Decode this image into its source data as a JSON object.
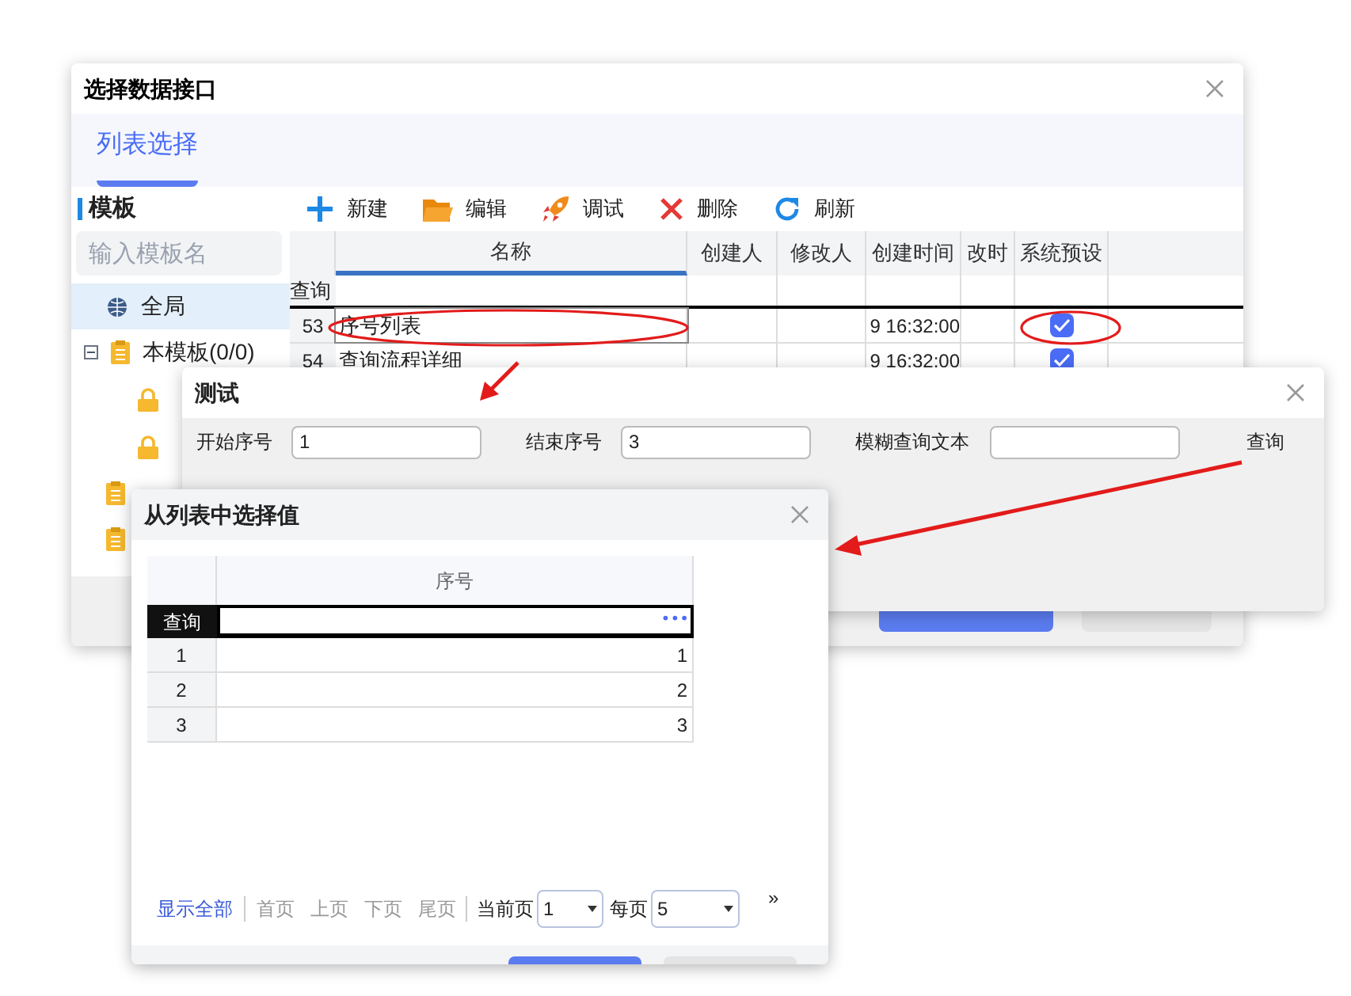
{
  "main_window": {
    "title": "选择数据接口",
    "tabs": [
      {
        "label": "列表选择",
        "selected": true
      }
    ],
    "sidebar": {
      "heading": "模板",
      "search": {
        "placeholder": "输入模板名"
      },
      "items": [
        {
          "label": "全局",
          "kind": "globe",
          "selected": true
        },
        {
          "label": "本模板(0/0)",
          "kind": "clipboard",
          "selected": false,
          "expanded": true,
          "children": [
            {
              "kind": "lock",
              "selected": false
            },
            {
              "kind": "lock",
              "selected": false
            }
          ]
        },
        {
          "kind": "clipboard",
          "selected": false
        },
        {
          "kind": "clipboard",
          "selected": false
        }
      ]
    },
    "toolbar": [
      {
        "kind": "new",
        "label": "新建"
      },
      {
        "kind": "edit",
        "label": "编辑"
      },
      {
        "kind": "debug",
        "label": "调试"
      },
      {
        "kind": "delete",
        "label": "删除"
      },
      {
        "kind": "refresh",
        "label": "刷新"
      }
    ],
    "table": {
      "columns": [
        "名称",
        "创建人",
        "修改人",
        "创建时间",
        "改时",
        "系统预设"
      ],
      "filter_label": "查询",
      "rows": [
        {
          "num": "53",
          "name": "序号列表",
          "created": "9 16:32:00",
          "preset": true,
          "selected": true
        },
        {
          "num": "54",
          "name": "查询流程详细",
          "created": "9 16:32:00",
          "preset": true,
          "selected": false
        }
      ]
    }
  },
  "test_window": {
    "title": "测试",
    "fields": [
      {
        "label": "开始序号",
        "value": "1"
      },
      {
        "label": "结束序号",
        "value": "3"
      },
      {
        "label": "模糊查询文本"
      }
    ],
    "query_button": "查询"
  },
  "picker_window": {
    "title": "从列表中选择值",
    "column": "序号",
    "filter_label": "查询",
    "filter_button": "•••",
    "rows": [
      {
        "num": "1",
        "value": "1"
      },
      {
        "num": "2",
        "value": "2"
      },
      {
        "num": "3",
        "value": "3"
      }
    ],
    "pager": {
      "show_all": "显示全部",
      "first": "首页",
      "prev": "上页",
      "next": "下页",
      "last": "尾页",
      "current_label": "当前页",
      "current": "1",
      "per_page_label": "每页",
      "per_page": "5",
      "more": "»"
    }
  }
}
